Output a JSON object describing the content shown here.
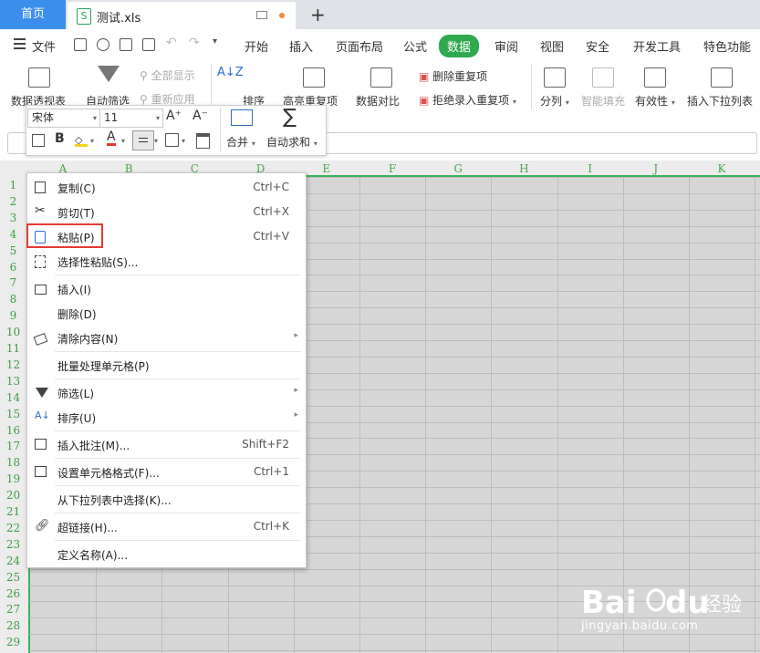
{
  "tabs": {
    "home": "首页",
    "file": "测试.xls",
    "file_icon": "S"
  },
  "menu": {
    "file_label": "文件",
    "items": [
      "开始",
      "插入",
      "页面布局",
      "公式",
      "数据",
      "审阅",
      "视图",
      "安全",
      "开发工具",
      "特色功能"
    ],
    "active": "数据"
  },
  "ribbon": {
    "pivot": "数据透视表",
    "filter": "自动筛选",
    "show_all": "全部显示",
    "reapply": "重新应用",
    "sort": "排序",
    "highlight_dup": "高亮重复项",
    "compare": "数据对比",
    "remove_dup": "删除重复项",
    "reject_dup": "拒绝录入重复项",
    "split": "分列",
    "smart_fill": "智能填充",
    "validity": "有效性",
    "insert_dropdown": "插入下拉列表"
  },
  "float_toolbar": {
    "font": "宋体",
    "size": "11",
    "merge": "合并",
    "autosum": "自动求和",
    "grow_font": "A⁺",
    "shrink_font": "A⁻",
    "bold": "B",
    "font_color_glyph": "A"
  },
  "grid": {
    "columns": [
      "A",
      "B",
      "C",
      "D",
      "E",
      "F",
      "G",
      "H",
      "I",
      "J",
      "K"
    ],
    "rows": [
      "1",
      "2",
      "3",
      "4",
      "5",
      "6",
      "7",
      "8",
      "9",
      "10",
      "11",
      "12",
      "13",
      "14",
      "15",
      "16",
      "17",
      "18",
      "19",
      "20",
      "21",
      "22",
      "23",
      "24",
      "25",
      "26",
      "27",
      "28",
      "29"
    ]
  },
  "context_menu": {
    "copy": {
      "label": "复制(C)",
      "shortcut": "Ctrl+C"
    },
    "cut": {
      "label": "剪切(T)",
      "shortcut": "Ctrl+X"
    },
    "paste": {
      "label": "粘贴(P)",
      "shortcut": "Ctrl+V"
    },
    "paste_special": {
      "label": "选择性粘贴(S)..."
    },
    "insert": {
      "label": "插入(I)"
    },
    "delete": {
      "label": "删除(D)"
    },
    "clear": {
      "label": "清除内容(N)"
    },
    "batch": {
      "label": "批量处理单元格(P)"
    },
    "filter": {
      "label": "筛选(L)"
    },
    "sort": {
      "label": "排序(U)"
    },
    "comment": {
      "label": "插入批注(M)...",
      "shortcut": "Shift+F2"
    },
    "format": {
      "label": "设置单元格格式(F)...",
      "shortcut": "Ctrl+1"
    },
    "pick_list": {
      "label": "从下拉列表中选择(K)..."
    },
    "hyperlink": {
      "label": "超链接(H)...",
      "shortcut": "Ctrl+K"
    },
    "define_name": {
      "label": "定义名称(A)..."
    }
  },
  "watermark": {
    "brand": "Bai",
    "brand2": "du",
    "jingyan": "经验",
    "url": "jingyan.baidu.com"
  },
  "colors": {
    "accent_green": "#2ea94f",
    "home_blue": "#3c8eec",
    "highlight_red": "#e53935",
    "grid_green": "#4aa54e"
  }
}
